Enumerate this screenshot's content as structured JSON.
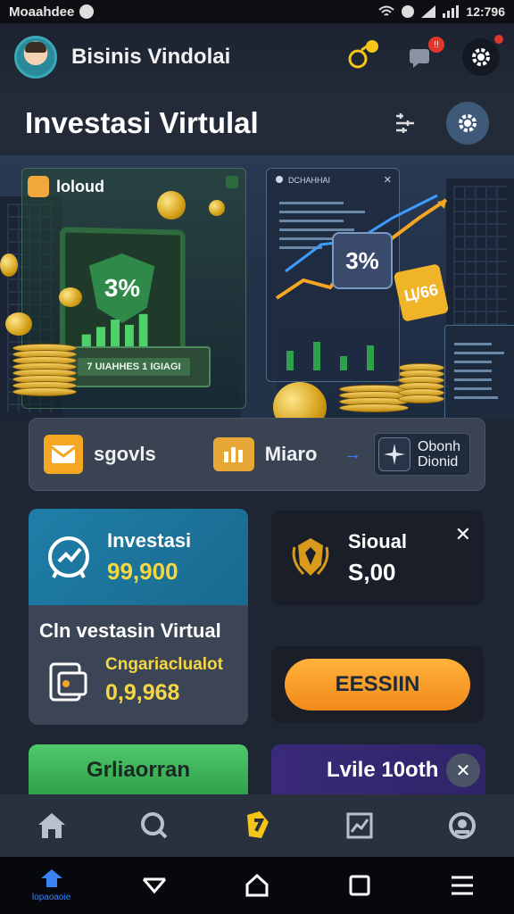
{
  "status_bar": {
    "carrier": "Moaahdee",
    "time": "12:796"
  },
  "header": {
    "app_name": "Bisinis Vindolai",
    "notification_badge": "",
    "message_badge": "!!"
  },
  "page": {
    "title": "Investasi Virtulal"
  },
  "hero": {
    "tag": "loloud",
    "monitor_percent": "3%",
    "plate_label": "7 UIAHHES 1 IGIAGI",
    "chart_panel_header": "DCHAHHAI",
    "chart_percent": "3%",
    "gold_tag": "Ц/66"
  },
  "tabs": {
    "tab1_label": "sgovls",
    "tab2_label": "Miaro",
    "tab3_line1": "Obonh",
    "tab3_line2": "Dionid"
  },
  "cards": {
    "investasi": {
      "title": "Investasi",
      "value": "99,900"
    },
    "virtual": {
      "heading": "Cln vestasin Virtual",
      "label": "Cngariaclualot",
      "value": "0,9,968"
    },
    "sioual": {
      "title": "Sioual",
      "value": "S,00"
    },
    "cta_button": "EESSIIN",
    "green_button": "Grliaorran",
    "purple_button": "Lvile 10oth"
  },
  "bottom_nav": {
    "items": [
      "home-icon",
      "search-icon",
      "finance-icon",
      "chart-icon",
      "profile-icon"
    ],
    "active_color": "#f5c518"
  },
  "system_nav": {
    "home_label": "lopaoaoie"
  },
  "colors": {
    "accent_yellow": "#f5d742",
    "accent_blue": "#1e7ea8",
    "cta_orange": "#f8a52a",
    "green": "#3fb85a",
    "purple": "#342670"
  }
}
